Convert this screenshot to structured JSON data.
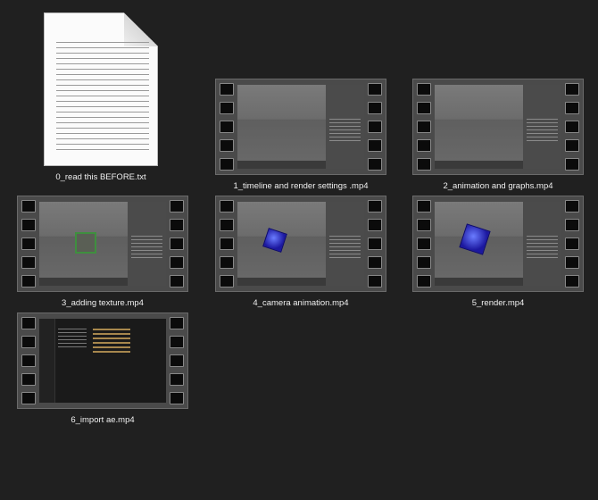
{
  "files": [
    {
      "name": "0_read this BEFORE.txt",
      "type": "text",
      "icon": "text-document-icon"
    },
    {
      "name": "1_timeline and render settings .mp4",
      "type": "video",
      "icon": "film-strip-icon"
    },
    {
      "name": "2_animation and graphs.mp4",
      "type": "video",
      "icon": "film-strip-icon"
    },
    {
      "name": "3_adding texture.mp4",
      "type": "video",
      "icon": "film-strip-icon"
    },
    {
      "name": "4_camera animation.mp4",
      "type": "video",
      "icon": "film-strip-icon"
    },
    {
      "name": "5_render.mp4",
      "type": "video",
      "icon": "film-strip-icon"
    },
    {
      "name": "6_import ae.mp4",
      "type": "video",
      "icon": "film-strip-icon"
    }
  ]
}
